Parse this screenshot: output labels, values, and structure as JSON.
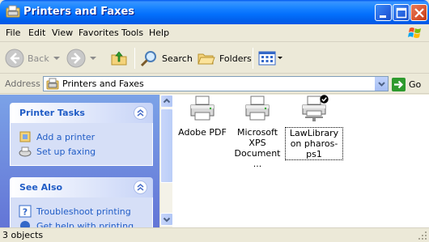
{
  "window": {
    "title": "Printers and Faxes"
  },
  "menu": [
    "File",
    "Edit",
    "View",
    "Favorites",
    "Tools",
    "Help"
  ],
  "toolbar": {
    "back": "Back",
    "search": "Search",
    "folders": "Folders"
  },
  "address": {
    "label": "Address",
    "value": "Printers and Faxes",
    "go": "Go"
  },
  "tasks": {
    "printer_tasks": {
      "title": "Printer Tasks",
      "items": [
        "Add a printer",
        "Set up faxing"
      ]
    },
    "see_also": {
      "title": "See Also",
      "items": [
        "Troubleshoot printing",
        "Get help with printing"
      ]
    }
  },
  "printers": [
    {
      "name": "Adobe PDF",
      "default": false
    },
    {
      "name": "Microsoft XPS Document ...",
      "default": false
    },
    {
      "name": "LawLibrary on pharos-ps1",
      "default": true
    }
  ],
  "status": {
    "text": "3 objects"
  },
  "colors": {
    "titlebar": "#0058EE",
    "taskpane": "#7BA2E7",
    "link": "#215DC6"
  }
}
